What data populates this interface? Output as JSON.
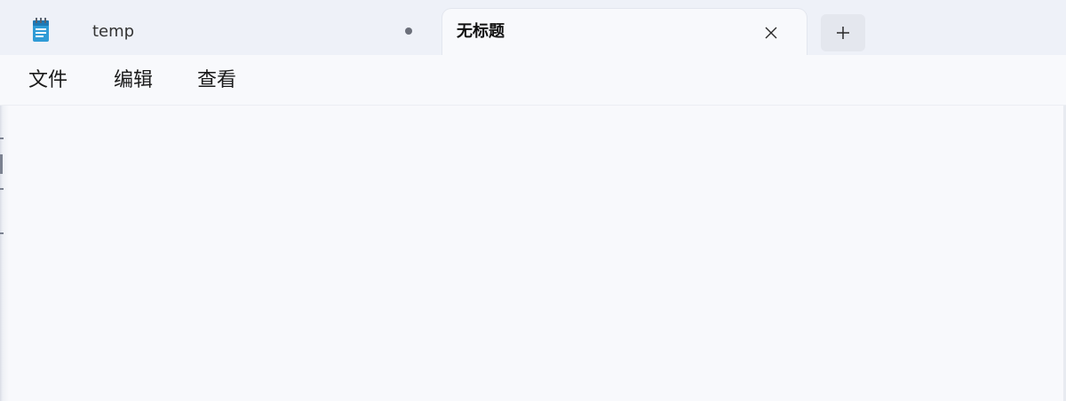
{
  "app": {
    "icon": "notepad-icon"
  },
  "tabs": [
    {
      "label": "temp",
      "modified_indicator": "unsaved-dot"
    },
    {
      "label": "无标题",
      "close_icon": "close-icon"
    }
  ],
  "new_tab": {
    "icon": "plus-icon"
  },
  "menu": {
    "items": [
      {
        "label": "文件"
      },
      {
        "label": "编辑"
      },
      {
        "label": "查看"
      }
    ]
  },
  "editor": {
    "content": ""
  },
  "colors": {
    "tabbar_bg": "#eef1f8",
    "window_bg": "#f8f9fc",
    "icon_blue": "#2f9bd6"
  }
}
